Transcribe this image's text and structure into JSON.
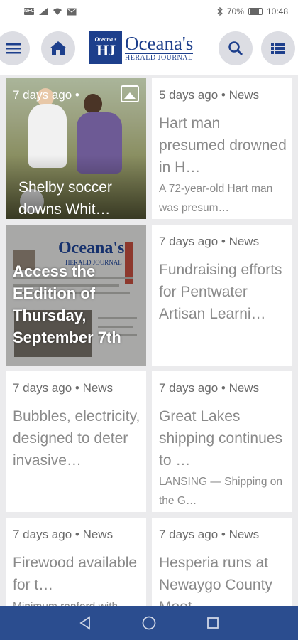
{
  "status_bar": {
    "nfc_label": "NFC",
    "battery": "70%",
    "time": "10:48"
  },
  "header": {
    "logo_badge_small": "Oceana's",
    "logo_badge_big": "HJ",
    "logo_name": "Oceana's",
    "logo_sub": "HERALD JOURNAL",
    "icons": [
      "menu-icon",
      "home-icon",
      "search-icon",
      "list-icon"
    ]
  },
  "feed": {
    "cards": [
      {
        "meta": "7 days ago •",
        "headline": "Shelby soccer downs Whit…",
        "has_image": true
      },
      {
        "meta": "5 days ago • News",
        "headline": "Hart man presumed drowned in H…",
        "summary": "A 72-year-old Hart man was presum…"
      },
      {
        "headline": "Access the EEdition of Thursday, September  7th",
        "has_image": true,
        "image_masthead": "Oceana's",
        "image_sub": "HERALD JOURNAL"
      },
      {
        "meta": "7 days ago • News",
        "headline": "Fundraising efforts for Pentwater Artisan Learni…"
      },
      {
        "meta": "7 days ago • News",
        "headline": "Bubbles, electricity, designed to deter invasive…"
      },
      {
        "meta": "7 days ago • News",
        "headline": "Great Lakes shipping continues to …",
        "summary": "LANSING — Shipping on the G…"
      },
      {
        "meta": "7 days ago • News",
        "headline": "Firewood available for t…",
        "summary": "Minimum ranford with"
      },
      {
        "meta": "7 days ago • News",
        "headline": "Hesperia runs at Newaygo County Meet"
      }
    ]
  },
  "colors": {
    "brand_blue": "#1d3f8c",
    "nav_bar": "#2b4d8f",
    "button_bg": "#dcdde3",
    "text_gray": "#8a8a8a"
  }
}
